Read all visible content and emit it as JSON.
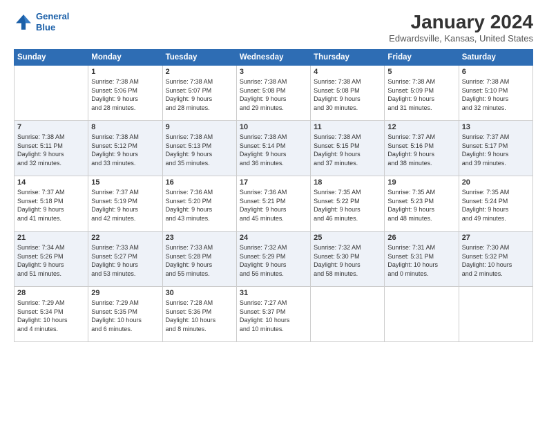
{
  "logo": {
    "line1": "General",
    "line2": "Blue"
  },
  "title": "January 2024",
  "subtitle": "Edwardsville, Kansas, United States",
  "days_of_week": [
    "Sunday",
    "Monday",
    "Tuesday",
    "Wednesday",
    "Thursday",
    "Friday",
    "Saturday"
  ],
  "weeks": [
    [
      {
        "day": "",
        "info": ""
      },
      {
        "day": "1",
        "info": "Sunrise: 7:38 AM\nSunset: 5:06 PM\nDaylight: 9 hours\nand 28 minutes."
      },
      {
        "day": "2",
        "info": "Sunrise: 7:38 AM\nSunset: 5:07 PM\nDaylight: 9 hours\nand 28 minutes."
      },
      {
        "day": "3",
        "info": "Sunrise: 7:38 AM\nSunset: 5:08 PM\nDaylight: 9 hours\nand 29 minutes."
      },
      {
        "day": "4",
        "info": "Sunrise: 7:38 AM\nSunset: 5:08 PM\nDaylight: 9 hours\nand 30 minutes."
      },
      {
        "day": "5",
        "info": "Sunrise: 7:38 AM\nSunset: 5:09 PM\nDaylight: 9 hours\nand 31 minutes."
      },
      {
        "day": "6",
        "info": "Sunrise: 7:38 AM\nSunset: 5:10 PM\nDaylight: 9 hours\nand 32 minutes."
      }
    ],
    [
      {
        "day": "7",
        "info": "Sunrise: 7:38 AM\nSunset: 5:11 PM\nDaylight: 9 hours\nand 32 minutes."
      },
      {
        "day": "8",
        "info": "Sunrise: 7:38 AM\nSunset: 5:12 PM\nDaylight: 9 hours\nand 33 minutes."
      },
      {
        "day": "9",
        "info": "Sunrise: 7:38 AM\nSunset: 5:13 PM\nDaylight: 9 hours\nand 35 minutes."
      },
      {
        "day": "10",
        "info": "Sunrise: 7:38 AM\nSunset: 5:14 PM\nDaylight: 9 hours\nand 36 minutes."
      },
      {
        "day": "11",
        "info": "Sunrise: 7:38 AM\nSunset: 5:15 PM\nDaylight: 9 hours\nand 37 minutes."
      },
      {
        "day": "12",
        "info": "Sunrise: 7:37 AM\nSunset: 5:16 PM\nDaylight: 9 hours\nand 38 minutes."
      },
      {
        "day": "13",
        "info": "Sunrise: 7:37 AM\nSunset: 5:17 PM\nDaylight: 9 hours\nand 39 minutes."
      }
    ],
    [
      {
        "day": "14",
        "info": "Sunrise: 7:37 AM\nSunset: 5:18 PM\nDaylight: 9 hours\nand 41 minutes."
      },
      {
        "day": "15",
        "info": "Sunrise: 7:37 AM\nSunset: 5:19 PM\nDaylight: 9 hours\nand 42 minutes."
      },
      {
        "day": "16",
        "info": "Sunrise: 7:36 AM\nSunset: 5:20 PM\nDaylight: 9 hours\nand 43 minutes."
      },
      {
        "day": "17",
        "info": "Sunrise: 7:36 AM\nSunset: 5:21 PM\nDaylight: 9 hours\nand 45 minutes."
      },
      {
        "day": "18",
        "info": "Sunrise: 7:35 AM\nSunset: 5:22 PM\nDaylight: 9 hours\nand 46 minutes."
      },
      {
        "day": "19",
        "info": "Sunrise: 7:35 AM\nSunset: 5:23 PM\nDaylight: 9 hours\nand 48 minutes."
      },
      {
        "day": "20",
        "info": "Sunrise: 7:35 AM\nSunset: 5:24 PM\nDaylight: 9 hours\nand 49 minutes."
      }
    ],
    [
      {
        "day": "21",
        "info": "Sunrise: 7:34 AM\nSunset: 5:26 PM\nDaylight: 9 hours\nand 51 minutes."
      },
      {
        "day": "22",
        "info": "Sunrise: 7:33 AM\nSunset: 5:27 PM\nDaylight: 9 hours\nand 53 minutes."
      },
      {
        "day": "23",
        "info": "Sunrise: 7:33 AM\nSunset: 5:28 PM\nDaylight: 9 hours\nand 55 minutes."
      },
      {
        "day": "24",
        "info": "Sunrise: 7:32 AM\nSunset: 5:29 PM\nDaylight: 9 hours\nand 56 minutes."
      },
      {
        "day": "25",
        "info": "Sunrise: 7:32 AM\nSunset: 5:30 PM\nDaylight: 9 hours\nand 58 minutes."
      },
      {
        "day": "26",
        "info": "Sunrise: 7:31 AM\nSunset: 5:31 PM\nDaylight: 10 hours\nand 0 minutes."
      },
      {
        "day": "27",
        "info": "Sunrise: 7:30 AM\nSunset: 5:32 PM\nDaylight: 10 hours\nand 2 minutes."
      }
    ],
    [
      {
        "day": "28",
        "info": "Sunrise: 7:29 AM\nSunset: 5:34 PM\nDaylight: 10 hours\nand 4 minutes."
      },
      {
        "day": "29",
        "info": "Sunrise: 7:29 AM\nSunset: 5:35 PM\nDaylight: 10 hours\nand 6 minutes."
      },
      {
        "day": "30",
        "info": "Sunrise: 7:28 AM\nSunset: 5:36 PM\nDaylight: 10 hours\nand 8 minutes."
      },
      {
        "day": "31",
        "info": "Sunrise: 7:27 AM\nSunset: 5:37 PM\nDaylight: 10 hours\nand 10 minutes."
      },
      {
        "day": "",
        "info": ""
      },
      {
        "day": "",
        "info": ""
      },
      {
        "day": "",
        "info": ""
      }
    ]
  ]
}
